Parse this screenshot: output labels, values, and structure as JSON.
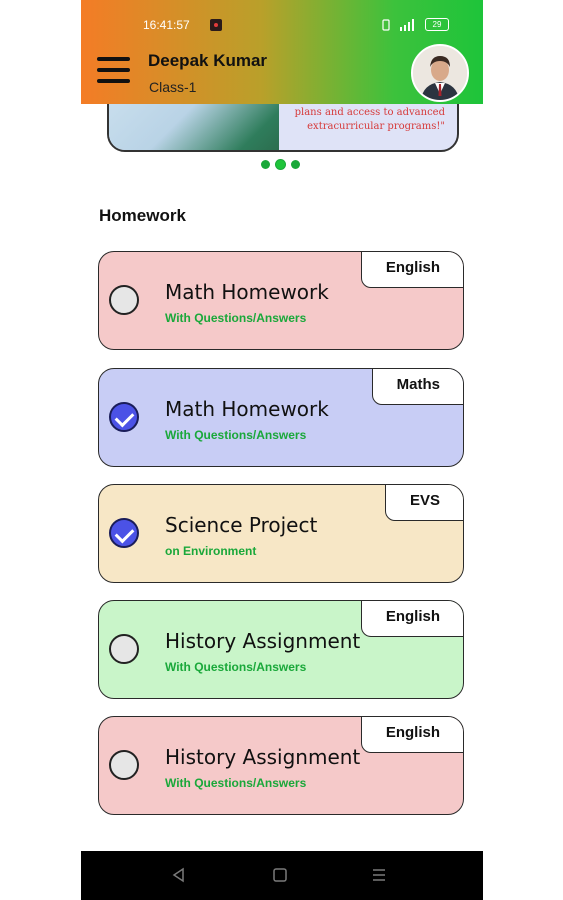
{
  "status_bar": {
    "time": "16:41:57",
    "battery": "29"
  },
  "header": {
    "user_name": "Deepak Kumar",
    "class_label": "Class-1"
  },
  "banner": {
    "text": "plans and access to advanced extracurricular programs!\"",
    "dots_count": 3
  },
  "homework": {
    "section_title": "Homework",
    "items": [
      {
        "title": "Math Homework",
        "subtitle": "With Questions/Answers",
        "subject": "English",
        "done": false,
        "bg": "#f5c9c9"
      },
      {
        "title": "Math Homework",
        "subtitle": "With Questions/Answers",
        "subject": "Maths",
        "done": true,
        "bg": "#c8cdf5"
      },
      {
        "title": "Science Project",
        "subtitle": "on Environment",
        "subject": "EVS",
        "done": true,
        "bg": "#f7e7c6"
      },
      {
        "title": "History Assignment",
        "subtitle": "With Questions/Answers",
        "subject": "English",
        "done": false,
        "bg": "#c9f5c9"
      },
      {
        "title": "History Assignment",
        "subtitle": "With Questions/Answers",
        "subject": "English",
        "done": false,
        "bg": "#f5c9c9"
      }
    ]
  },
  "navbar": {
    "icons": [
      "back-icon",
      "home-icon",
      "menu-icon"
    ]
  }
}
